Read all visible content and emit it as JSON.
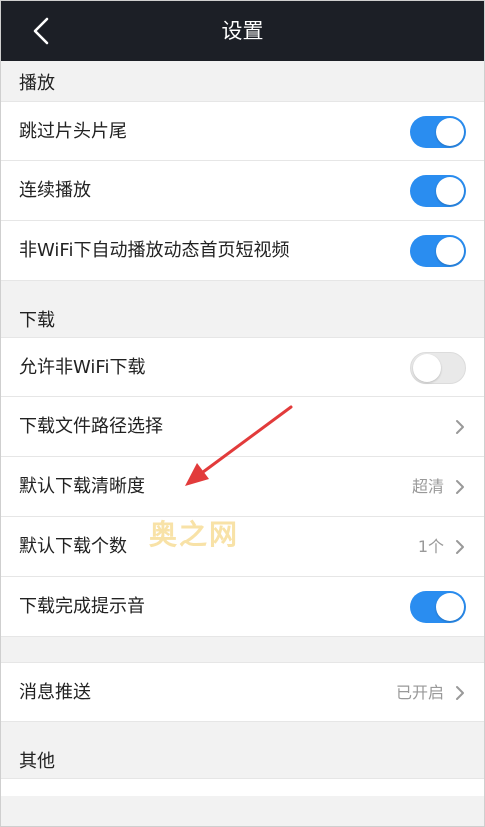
{
  "header": {
    "title": "设置"
  },
  "sections": {
    "playback": {
      "title": "播放",
      "items": [
        {
          "label": "跳过片头片尾",
          "toggle": true
        },
        {
          "label": "连续播放",
          "toggle": true
        },
        {
          "label": "非WiFi下自动播放动态首页短视频",
          "toggle": true
        }
      ]
    },
    "download": {
      "title": "下载",
      "items": [
        {
          "label": "允许非WiFi下载",
          "toggle": false
        },
        {
          "label": "下载文件路径选择"
        },
        {
          "label": "默认下载清晰度",
          "value": "超清"
        },
        {
          "label": "默认下载个数",
          "value": "1个"
        },
        {
          "label": "下载完成提示音",
          "toggle": true
        }
      ]
    },
    "push": {
      "items": [
        {
          "label": "消息推送",
          "value": "已开启"
        }
      ]
    },
    "other": {
      "title": "其他"
    }
  },
  "watermark": "奥之网",
  "colors": {
    "header_bg": "#1c1f26",
    "accent": "#2a8df0",
    "arrow": "#e23b3b"
  }
}
